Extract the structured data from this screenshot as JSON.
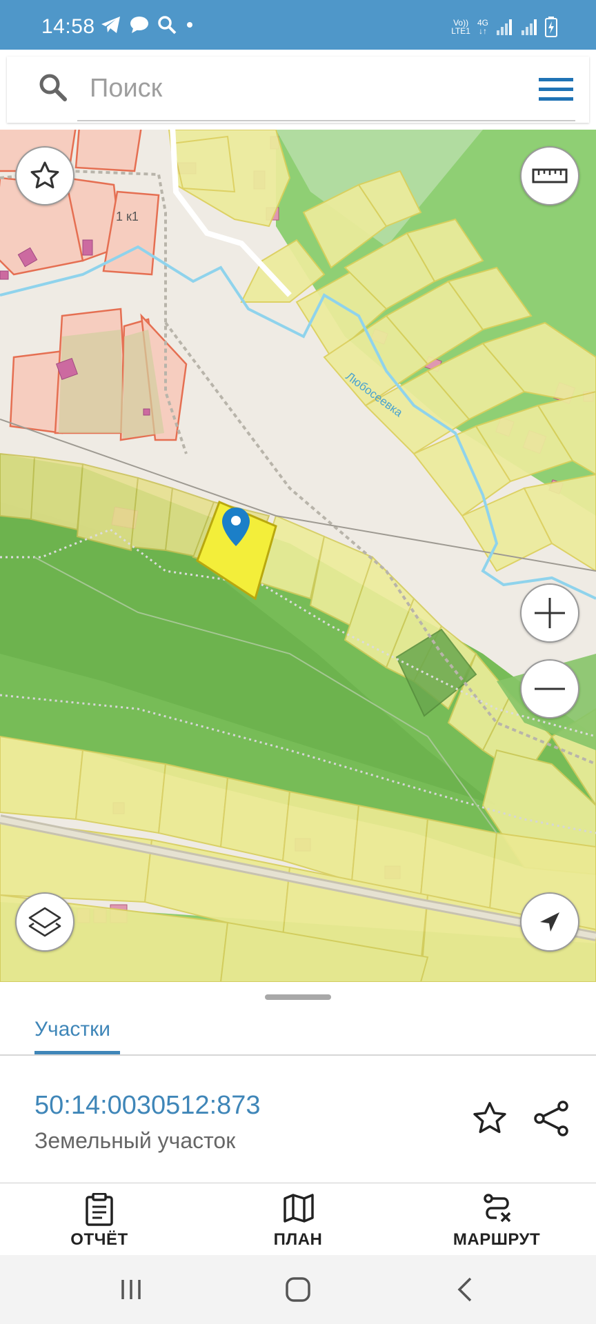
{
  "status_bar": {
    "time": "14:58",
    "left_icons": [
      "telegram-icon",
      "chat-bubble-icon",
      "search-icon",
      "dot-icon"
    ],
    "network_label_top": "Vo))",
    "network_label_bottom": "LTE1",
    "network_type": "4G",
    "right_icons": [
      "signal-icon",
      "signal-icon",
      "battery-charging-icon"
    ]
  },
  "search": {
    "placeholder": "Поиск",
    "value": ""
  },
  "map": {
    "building_label": "1 к1",
    "river_label": "Любосеевка",
    "controls": {
      "favorite": "star-icon",
      "ruler": "ruler-icon",
      "zoom_in": "plus-icon",
      "zoom_out": "minus-icon",
      "layers": "layers-icon",
      "locate": "navigation-arrow-icon"
    },
    "colors": {
      "parcel_selected": "#f3ee3a",
      "parcel": "#f1ef9a",
      "forest": "#7cc05a",
      "urban_plot": "#f6c8bd",
      "river": "#8fd3ec",
      "marker": "#1b7fc8"
    }
  },
  "sheet": {
    "tabs": [
      {
        "label": "Участки",
        "active": true
      }
    ],
    "parcel_id": "50:14:0030512:873",
    "parcel_type": "Земельный участок"
  },
  "bottom_nav": {
    "report": "ОТЧЁТ",
    "plan": "ПЛАН",
    "route": "МАРШРУТ"
  },
  "system_nav": [
    "recent-apps-icon",
    "home-icon",
    "back-icon"
  ]
}
